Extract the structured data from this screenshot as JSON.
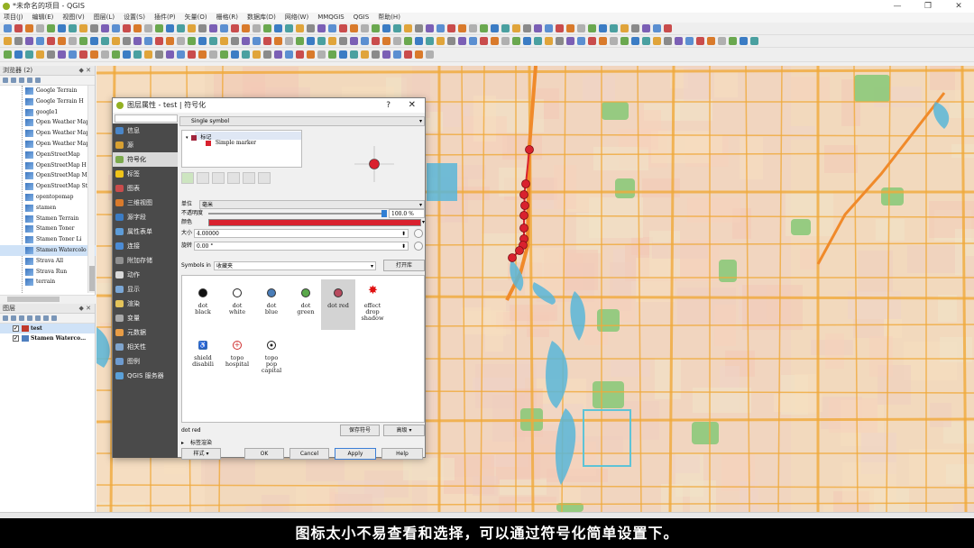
{
  "window": {
    "title": "*未命名的项目 - QGIS",
    "controls": [
      "—",
      "❐",
      "✕"
    ]
  },
  "menu": [
    "项目(J)",
    "编辑(E)",
    "视图(V)",
    "图层(L)",
    "设置(S)",
    "插件(P)",
    "矢量(O)",
    "栅格(R)",
    "数据库(D)",
    "网络(W)",
    "MMQGIS",
    "QGIS",
    "帮助(H)"
  ],
  "browser": {
    "title": "浏览器 (2)",
    "panel_controls": "◆ ✕",
    "items": [
      "Google Terrain",
      "Google Terrain H",
      "google1",
      "Open Weather Map",
      "Open Weather Map",
      "Open Weather Map",
      "OpenStreetMap",
      "OpenStreetMap H",
      "OpenStreetMap Mo",
      "OpenStreetMap St",
      "opentopomap",
      "stamen",
      "Stamen Terrain",
      "Stamen Toner",
      "Stamen Toner Li",
      "Stamen Watercolo",
      "Strava All",
      "Strava Run",
      "terrain"
    ],
    "selected_index": 15
  },
  "layers": {
    "title": "图层",
    "panel_controls": "◆ ✕",
    "items": [
      {
        "name": "test",
        "checked": true,
        "swatch": "#c0392b"
      },
      {
        "name": "Stamen Waterco…",
        "checked": true,
        "swatch": "#4f7fbf"
      }
    ]
  },
  "dialog": {
    "title": "图层属性 - test | 符号化",
    "help": "?",
    "close": "✕",
    "nav": [
      {
        "label": "信息",
        "icon": "#4a86c8"
      },
      {
        "label": "源",
        "icon": "#d8a031"
      },
      {
        "label": "符号化",
        "icon": "#7ba94c",
        "active": true
      },
      {
        "label": "标签",
        "icon": "#f0c419"
      },
      {
        "label": "图表",
        "icon": "#c94c4c"
      },
      {
        "label": "三维视图",
        "icon": "#d97a2b"
      },
      {
        "label": "源字段",
        "icon": "#3b7cc4"
      },
      {
        "label": "属性表单",
        "icon": "#5d9cd8"
      },
      {
        "label": "连接",
        "icon": "#4b8bd4"
      },
      {
        "label": "附加存储",
        "icon": "#909090"
      },
      {
        "label": "动作",
        "icon": "#d9d9d9"
      },
      {
        "label": "显示",
        "icon": "#7aa7d6"
      },
      {
        "label": "渲染",
        "icon": "#e5c45a"
      },
      {
        "label": "变量",
        "icon": "#aaaaaa"
      },
      {
        "label": "元数据",
        "icon": "#e89c45"
      },
      {
        "label": "相关性",
        "icon": "#7fa4cc"
      },
      {
        "label": "图例",
        "icon": "#6d9bd0"
      },
      {
        "label": "QGIS 服务器",
        "icon": "#5aa0d8"
      }
    ],
    "symbol_type": "Single symbol",
    "tree_root": "标记",
    "tree_child": "Simple marker",
    "unit_label": "单位",
    "unit_value": "毫米",
    "opacity_label": "不透明度",
    "opacity_value": "100.0 %",
    "color_label": "颜色",
    "color_value": "#d9212e",
    "size_label": "大小",
    "size_value": "4.00000",
    "rotation_label": "旋转",
    "rotation_value": "0.00 °",
    "symbols_in_label": "Symbols in",
    "symbols_in_value": "收藏夹",
    "open_library": "打开库",
    "gallery": [
      {
        "label": "dot\nblack",
        "kind": "dot",
        "color": "#111111"
      },
      {
        "label": "dot\nwhite",
        "kind": "ring",
        "color": "#ffffff"
      },
      {
        "label": "dot\nblue",
        "kind": "dot",
        "color": "#4a7db8"
      },
      {
        "label": "dot\ngreen",
        "kind": "dot",
        "color": "#5aa84a"
      },
      {
        "label": "dot red",
        "kind": "dot",
        "color": "#b84a5e",
        "selected": true
      },
      {
        "label": "effect\ndrop\nshadow",
        "kind": "star",
        "color": "#e01010"
      },
      {
        "label": "shield\ndisabili",
        "kind": "shield",
        "color": "#3c6fb8"
      },
      {
        "label": "topo\nhospital",
        "kind": "hospital",
        "color": "#d03030"
      },
      {
        "label": "topo\npop\ncapital",
        "kind": "capital",
        "color": "#222222"
      }
    ],
    "selected_symbol": "dot red",
    "save_symbol": "保存符号",
    "advanced": "高级",
    "layer_rendering": "标签渲染",
    "style_btn": "样式",
    "ok": "OK",
    "cancel": "Cancel",
    "apply": "Apply",
    "help_btn": "Help"
  },
  "map": {
    "route_points": 10,
    "route_color": "#d9212e"
  },
  "caption": "图标太小不易查看和选择，可以通过符号化简单设置下。"
}
